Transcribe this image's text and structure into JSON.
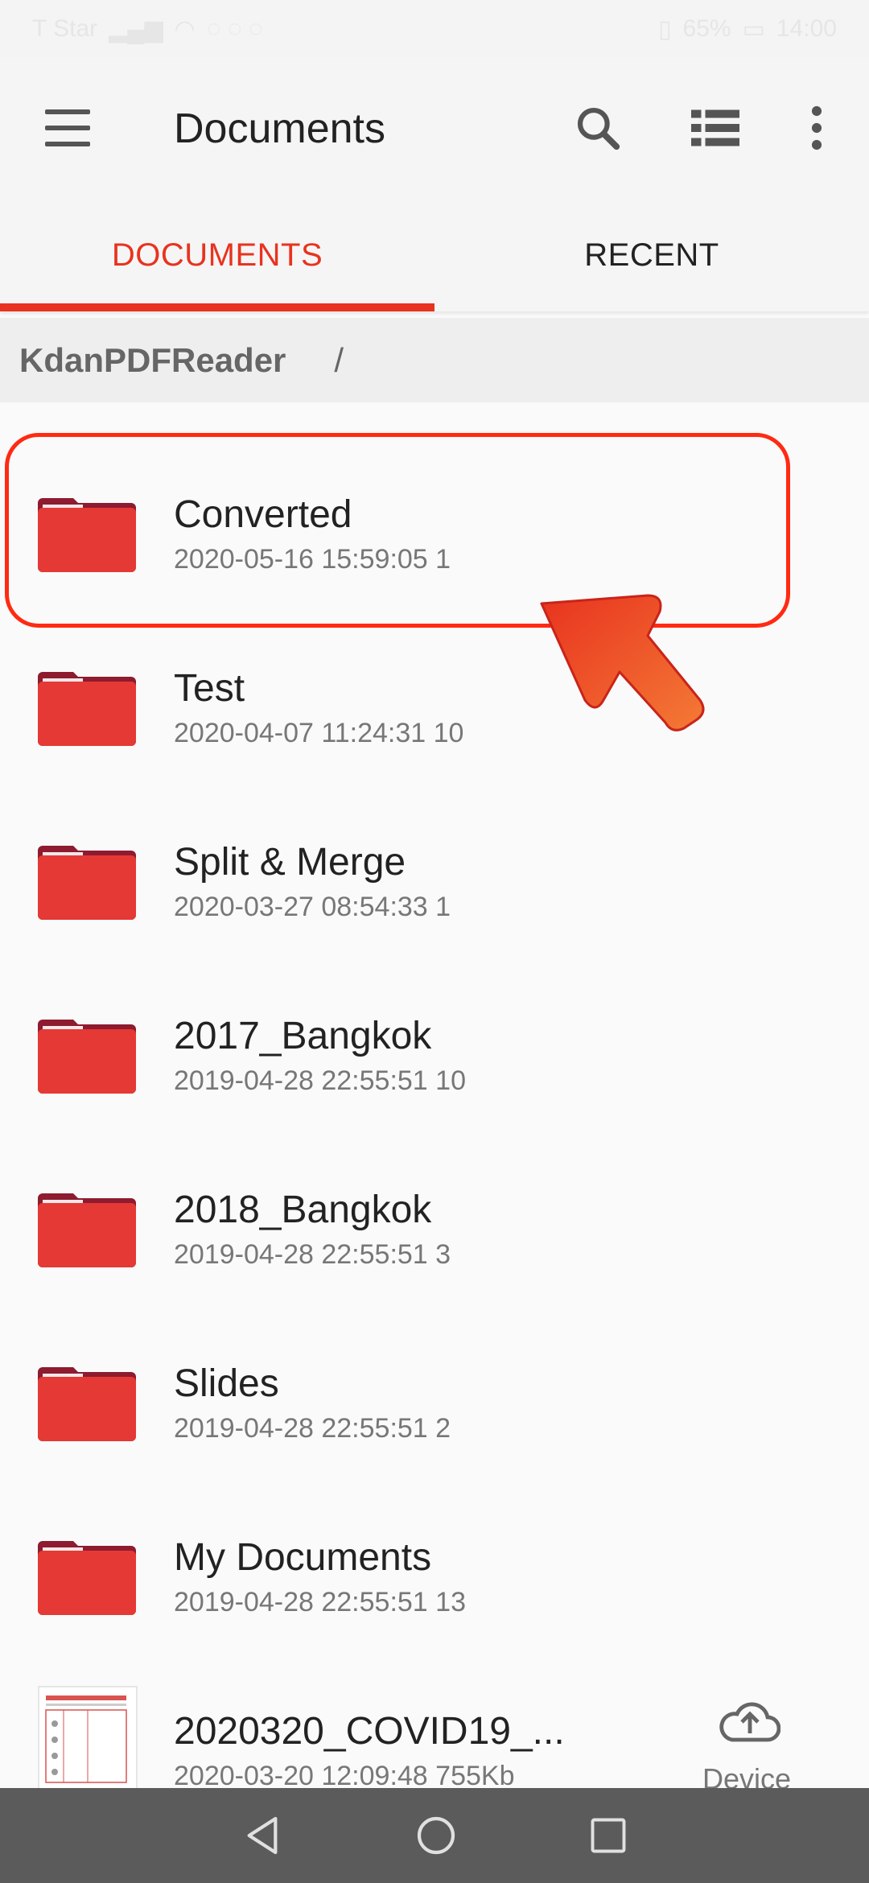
{
  "status_bar": {
    "carrier": "T Star",
    "battery": "65%",
    "time": "14:00"
  },
  "app_bar": {
    "title": "Documents"
  },
  "tabs": [
    {
      "label": "DOCUMENTS"
    },
    {
      "label": "RECENT"
    }
  ],
  "breadcrumb": {
    "root": "KdanPDFReader",
    "separator": "/"
  },
  "items": [
    {
      "name": "Converted",
      "meta": "2020-05-16 15:59:05 1"
    },
    {
      "name": "Test",
      "meta": "2020-04-07 11:24:31 10"
    },
    {
      "name": "Split & Merge",
      "meta": "2020-03-27 08:54:33 1"
    },
    {
      "name": "2017_Bangkok",
      "meta": "2019-04-28 22:55:51 10"
    },
    {
      "name": "2018_Bangkok",
      "meta": "2019-04-28 22:55:51 3"
    },
    {
      "name": "Slides",
      "meta": "2019-04-28 22:55:51 2"
    },
    {
      "name": "My Documents",
      "meta": "2019-04-28 22:55:51 13"
    },
    {
      "name": "2020320_COVID19_...",
      "meta": "2020-03-20 12:09:48 755Kb"
    }
  ],
  "device": {
    "label": "Device"
  },
  "colors": {
    "accent": "#e8331f",
    "folder": "#e53935",
    "folder_tab": "#8e1b2f"
  }
}
